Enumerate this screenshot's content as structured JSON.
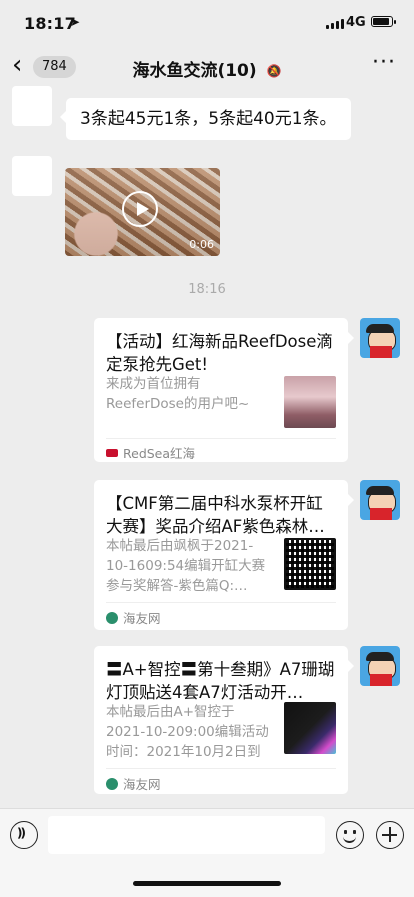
{
  "status": {
    "time": "18:17",
    "network": "4G",
    "battery_level": 0.8
  },
  "nav": {
    "back_count": "784",
    "title": "海水鱼交流(10)"
  },
  "messages": {
    "text1": "3条起45元1条，5条起40元1条。",
    "video_duration": "0:06",
    "timestamp": "18:16"
  },
  "cards": [
    {
      "title": "【活动】红海新品ReefDose滴定泵抢先Get!",
      "desc": "来成为首位拥有ReeferDose的用户吧~",
      "source": "RedSea红海"
    },
    {
      "title": "【CMF第二届中科水泵杯开缸大赛】奖品介绍AF紫色森林…",
      "desc": "本帖最后由飒枫于2021-10-1609:54编辑开缸大赛参与奖解答-紫色篇Q:…",
      "source": "海友网"
    },
    {
      "title": "〓A+智控〓第十叁期》A7珊瑚灯顶贴送4套A7灯活动开…",
      "desc": "本帖最后由A+智控于2021-10-209:00编辑活动时间：2021年10月2日到1…",
      "source": "海友网"
    }
  ],
  "colors": {
    "background": "#ededed",
    "bubble": "#ffffff",
    "redsea": "#c8102e",
    "haiyou": "#2a8f6c"
  },
  "icons": [
    "back-chevron-icon",
    "mute-bell-icon",
    "more-dots-icon",
    "play-icon",
    "voice-icon",
    "emoji-icon",
    "plus-icon"
  ]
}
